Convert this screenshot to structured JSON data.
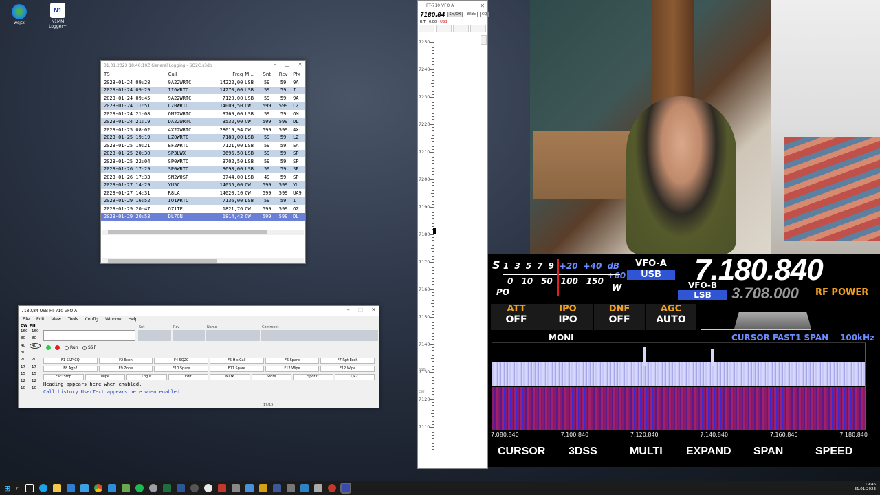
{
  "desktop": {
    "icons": [
      {
        "label": "wsjtx"
      },
      {
        "label": "N1MM Logger+"
      }
    ]
  },
  "log_window": {
    "title": "31.01.2023 18:46:10Z  General Logging - SQ2C.s3db",
    "columns": [
      "TS",
      "Call",
      "Freq",
      "M...",
      "Snt",
      "Rcv",
      "Pfx"
    ],
    "rows": [
      {
        "ts": "2023-01-24 09:28",
        "call": "9A22WRTC",
        "freq": "14222,00",
        "mode": "USB",
        "snt": "59",
        "rcv": "59",
        "pfx": "9A"
      },
      {
        "ts": "2023-01-24 09:29",
        "call": "II6WRTC",
        "freq": "14270,00",
        "mode": "USB",
        "snt": "59",
        "rcv": "59",
        "pfx": "I"
      },
      {
        "ts": "2023-01-24 09:45",
        "call": "9A22WRTC",
        "freq": "7120,00",
        "mode": "USB",
        "snt": "59",
        "rcv": "59",
        "pfx": "9A"
      },
      {
        "ts": "2023-01-24 11:51",
        "call": "LZ0WRTC",
        "freq": "14009,50",
        "mode": "CW",
        "snt": "599",
        "rcv": "599",
        "pfx": "LZ"
      },
      {
        "ts": "2023-01-24 21:08",
        "call": "OM22WRTC",
        "freq": "3769,00",
        "mode": "LSB",
        "snt": "59",
        "rcv": "59",
        "pfx": "OM"
      },
      {
        "ts": "2023-01-24 21:19",
        "call": "DA22WRTC",
        "freq": "3532,00",
        "mode": "CW",
        "snt": "599",
        "rcv": "599",
        "pfx": "DL"
      },
      {
        "ts": "2023-01-25 08:02",
        "call": "4X22WRTC",
        "freq": "28019,94",
        "mode": "CW",
        "snt": "599",
        "rcv": "599",
        "pfx": "4X"
      },
      {
        "ts": "2023-01-25 19:19",
        "call": "LZ0WRTC",
        "freq": "7180,00",
        "mode": "LSB",
        "snt": "59",
        "rcv": "59",
        "pfx": "LZ"
      },
      {
        "ts": "2023-01-25 19:21",
        "call": "EF2WRTC",
        "freq": "7121,00",
        "mode": "LSB",
        "snt": "59",
        "rcv": "59",
        "pfx": "EA"
      },
      {
        "ts": "2023-01-25 20:30",
        "call": "SP3LWX",
        "freq": "3696,50",
        "mode": "LSB",
        "snt": "59",
        "rcv": "59",
        "pfx": "SP"
      },
      {
        "ts": "2023-01-25 22:04",
        "call": "SP0WRTC",
        "freq": "3702,50",
        "mode": "LSB",
        "snt": "59",
        "rcv": "59",
        "pfx": "SP"
      },
      {
        "ts": "2023-01-26 17:29",
        "call": "SP0WRTC",
        "freq": "3698,00",
        "mode": "LSB",
        "snt": "59",
        "rcv": "59",
        "pfx": "SP"
      },
      {
        "ts": "2023-01-26 17:33",
        "call": "SN2WOSP",
        "freq": "3744,00",
        "mode": "LSB",
        "snt": "49",
        "rcv": "59",
        "pfx": "SP"
      },
      {
        "ts": "2023-01-27 14:29",
        "call": "YU5C",
        "freq": "14035,00",
        "mode": "CW",
        "snt": "599",
        "rcv": "599",
        "pfx": "YU"
      },
      {
        "ts": "2023-01-27 14:31",
        "call": "R8LA",
        "freq": "14020,10",
        "mode": "CW",
        "snt": "599",
        "rcv": "599",
        "pfx": "UA9"
      },
      {
        "ts": "2023-01-29 16:52",
        "call": "IO1WRTC",
        "freq": "7136,00",
        "mode": "LSB",
        "snt": "59",
        "rcv": "59",
        "pfx": "I"
      },
      {
        "ts": "2023-01-29 20:47",
        "call": "OZ1TF",
        "freq": "1821,76",
        "mode": "CW",
        "snt": "599",
        "rcv": "599",
        "pfx": "OZ"
      },
      {
        "ts": "2023-01-29 20:53",
        "call": "DL7ON",
        "freq": "1814,42",
        "mode": "CW",
        "snt": "599",
        "rcv": "599",
        "pfx": "DL"
      }
    ]
  },
  "entry_window": {
    "title": "7180,84 USB FT-710 VFO A",
    "menu": [
      "File",
      "Edit",
      "View",
      "Tools",
      "Config",
      "Window",
      "Help"
    ],
    "field_headers": [
      "Snt",
      "Rcv",
      "Name",
      "Comment"
    ],
    "band_header": [
      "CW",
      "PH"
    ],
    "band_rows": [
      [
        "160",
        "160"
      ],
      [
        "80",
        "80"
      ],
      [
        "40",
        "40"
      ],
      [
        "30",
        ""
      ],
      [
        "20",
        "20"
      ],
      [
        "17",
        "17"
      ],
      [
        "15",
        "15"
      ],
      [
        "12",
        "12"
      ],
      [
        "10",
        "10"
      ]
    ],
    "radio_run": "Run",
    "radio_sp": "S&P",
    "fkeys": [
      [
        "F1 S&P CQ",
        "F2 Exch",
        "F4 SQ2C",
        "F5 His Call",
        "F6 Spare",
        "F7 Rpt Exch"
      ],
      [
        "F8 Agn?",
        "F9 Zone",
        "F10 Spare",
        "F11 Spare",
        "F12 Wipe",
        "F12 Wipe"
      ],
      [
        "Esc: Stop",
        "Wipe",
        "Log It",
        "Edit",
        "Mark",
        "Store",
        "Spot It",
        "QRZ"
      ]
    ],
    "info_lines": [
      "Heading appears here when enabled.",
      "Call history UserText appears here when enabled."
    ],
    "status": "17/15"
  },
  "bandmap": {
    "title": "FT-710 VFO A",
    "freq": "7180,84",
    "btn_smdx": "Sm/DX",
    "btn_wide": "Wide",
    "btn_cq": "CQ",
    "rit_label": "RIT",
    "rit_value": "0.00",
    "mode": "USB",
    "ticks": [
      "7250",
      "7240",
      "7230",
      "7220",
      "7210",
      "7200",
      "7190",
      "7180",
      "7170",
      "7160",
      "7150",
      "7140",
      "7130",
      "7120",
      "7110"
    ],
    "ssb_label": "SSB",
    "cw_label": "CW"
  },
  "radio": {
    "smeter_s": "S",
    "scale_top": [
      "1",
      "3",
      "5",
      "7",
      "9",
      "+20",
      "+40",
      "dB +60"
    ],
    "scale_bottom": [
      "0",
      "10",
      "50",
      "100",
      "150"
    ],
    "po_label": "PO",
    "w_label": "W",
    "vfo_a_label": "VFO-A",
    "vfo_a_mode": "USB",
    "vfo_a_freq": "7.180.840",
    "vfo_b_label": "VFO-B",
    "vfo_b_mode": "LSB",
    "vfo_b_freq": "3.708.000",
    "rf_power": "RF POWER",
    "funcs": [
      {
        "label": "ATT",
        "value": "OFF"
      },
      {
        "label": "IPO",
        "value": "IPO"
      },
      {
        "label": "DNF",
        "value": "OFF"
      },
      {
        "label": "AGC",
        "value": "AUTO"
      }
    ],
    "moni": "MONI",
    "cursor_info": "CURSOR FAST1  SPAN",
    "span_value": "100kHz",
    "freq_axis": [
      "7.080.840",
      "7.100.840",
      "7.120.840",
      "7.140.840",
      "7.160.840",
      "7.180.840"
    ],
    "soft_buttons": [
      "CURSOR",
      "3DSS",
      "MULTI",
      "EXPAND",
      "SPAN",
      "SPEED"
    ]
  },
  "taskbar": {
    "time": "19:46",
    "date": "31.01.2023"
  }
}
